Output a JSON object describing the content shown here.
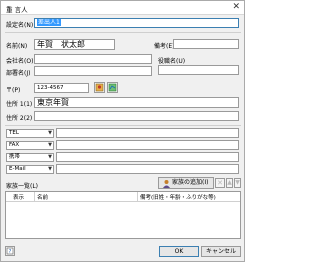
{
  "window": {
    "title": "重 言人",
    "close_glyph": "✕"
  },
  "fields": {
    "setting_name": {
      "label": "設定名(N)",
      "value": "差出人1"
    },
    "name": {
      "label": "名前(N)",
      "value": "年賀　状太郎"
    },
    "remarks": {
      "label": "備考(E)",
      "value": ""
    },
    "company": {
      "label": "会社名(O)",
      "value": ""
    },
    "title": {
      "label": "役職名(U)",
      "value": ""
    },
    "department": {
      "label": "部署名(J)",
      "value": ""
    },
    "postal": {
      "label": "〒(P)",
      "value": "123-4567"
    },
    "address1": {
      "label": "住所 1(1)",
      "value": "東京年賀"
    },
    "address2": {
      "label": "住所 2(2)",
      "value": ""
    }
  },
  "contacts": [
    {
      "type": "TEL",
      "value": ""
    },
    {
      "type": "FAX",
      "value": ""
    },
    {
      "type": "携帯",
      "value": ""
    },
    {
      "type": "E-Mail",
      "value": ""
    }
  ],
  "family": {
    "label": "家族一覧(L)",
    "add_button": "家族の追加(I)",
    "columns": [
      "表示",
      "名前",
      "備考(旧姓・年齢・ふりがな等)"
    ]
  },
  "footer": {
    "ok": "OK",
    "cancel": "キャンセル"
  },
  "colors": {
    "accent": "#3399ff",
    "window_bg": "#f0f0f0"
  },
  "icons": [
    "address-book-icon",
    "map-icon",
    "family-add-icon",
    "delete-icon",
    "up-arrow-icon",
    "down-arrow-icon",
    "help-icon",
    "dropdown-arrow-icon",
    "close-icon"
  ]
}
